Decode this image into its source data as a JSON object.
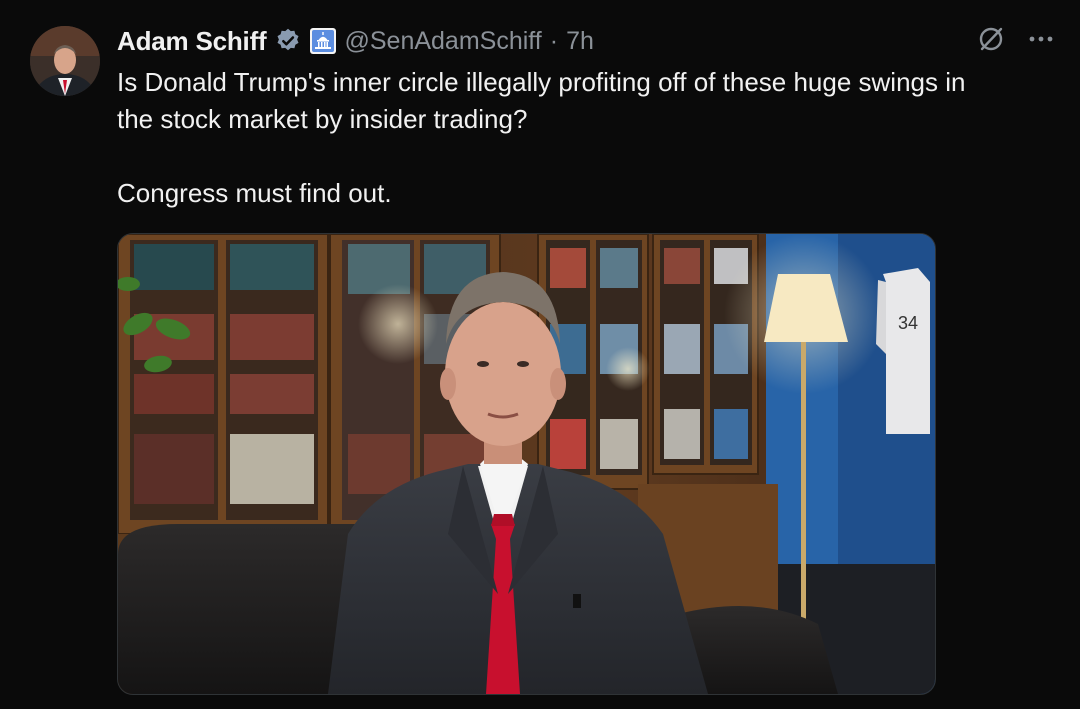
{
  "author": {
    "display_name": "Adam Schiff",
    "handle": "@SenAdamSchiff",
    "separator": "·",
    "timestamp": "7h",
    "verified_icon": "verified-badge-icon",
    "affiliation_icon": "capitol-building-icon"
  },
  "tweet": {
    "line1": "Is Donald Trump's inner circle illegally profiting off of these huge swings in",
    "line2": "the stock market by insider trading?",
    "line3": "Congress must find out."
  },
  "actions": {
    "grok_icon": "grok-slash-circle-icon",
    "more_icon": "more-dots-icon"
  },
  "media": {
    "type": "video-thumbnail"
  },
  "colors": {
    "background": "#0a0a0a",
    "text": "#f1f1f1",
    "secondary_text": "#8b9198",
    "verified": "#8a9bb0",
    "tie": "#c8102e"
  }
}
